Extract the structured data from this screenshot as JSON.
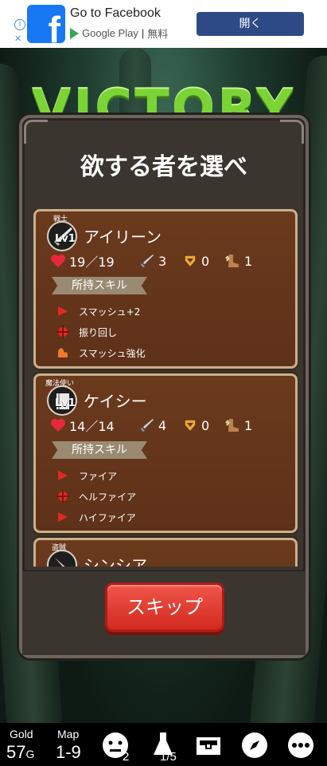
{
  "ad": {
    "title": "Go to Facebook",
    "store": "Google Play",
    "separator": "|",
    "price": "無料",
    "button": "開く",
    "logo_letter": "f"
  },
  "banner": {
    "text": "VICTORY"
  },
  "panel": {
    "title": "欲する者を選べ",
    "skills_heading": "所持スキル",
    "skip_label": "スキップ"
  },
  "characters": [
    {
      "role": "戦士",
      "level": "Lv1",
      "name": "アイリーン",
      "hp": "19／19",
      "attack": "3",
      "defense": "0",
      "speed": "1",
      "skills": [
        "スマッシュ+2",
        "振り回し",
        "スマッシュ強化"
      ]
    },
    {
      "role": "魔法使い",
      "level": "Lv1",
      "name": "ケイシー",
      "hp": "14／14",
      "attack": "4",
      "defense": "0",
      "speed": "1",
      "skills": [
        "ファイア",
        "ヘルファイア",
        "ハイファイア"
      ]
    },
    {
      "role": "盗賊",
      "name": "シンシア"
    }
  ],
  "bottom_bar": {
    "gold_label": "Gold",
    "gold_value": "57",
    "gold_unit": "G",
    "map_label": "Map",
    "map_value": "1-9",
    "party_count": "2",
    "potion_count": "1/5"
  },
  "colors": {
    "victory": "#7bd436",
    "card": "#6b3a1d",
    "skip_button": "#e2392e",
    "ad_button": "#2e4a86"
  },
  "icons": [
    "heart-icon",
    "sword-icon",
    "shield-icon",
    "boot-icon",
    "skill-icon",
    "face-icon",
    "potion-icon",
    "chest-icon",
    "compass-icon",
    "more-icon"
  ]
}
